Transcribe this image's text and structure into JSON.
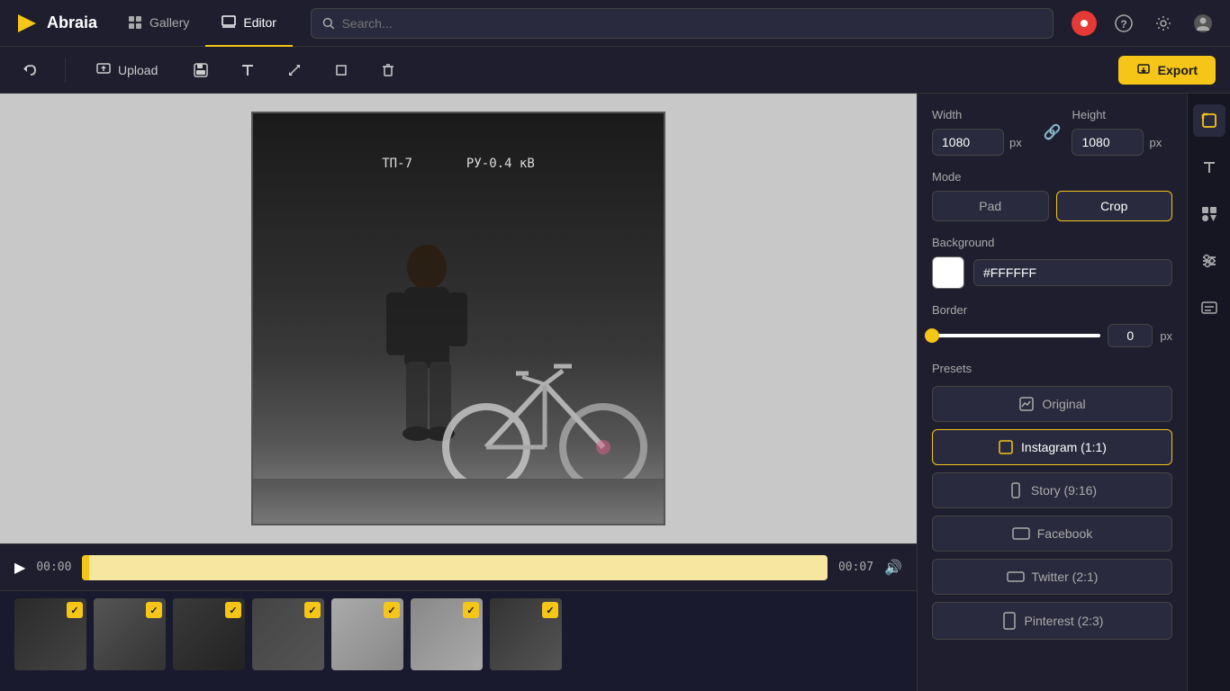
{
  "app": {
    "logo_text": "Abraia",
    "nav": {
      "gallery_label": "Gallery",
      "editor_label": "Editor"
    },
    "search_placeholder": "Search..."
  },
  "toolbar": {
    "upload_label": "Upload",
    "export_label": "Export"
  },
  "canvas": {
    "photo_text1": "ТП-7",
    "photo_text2": "РУ-0.4 кВ"
  },
  "timeline": {
    "current_time": "00:00",
    "total_time": "00:07"
  },
  "right_panel": {
    "width_label": "Width",
    "height_label": "Height",
    "width_value": "1080",
    "height_value": "1080",
    "px_label": "px",
    "mode_label": "Mode",
    "pad_label": "Pad",
    "crop_label": "Crop",
    "background_label": "Background",
    "bg_color_value": "#FFFFFF",
    "border_label": "Border",
    "border_value": "0",
    "border_px": "px",
    "presets_label": "Presets",
    "preset_original": "Original",
    "preset_instagram": "Instagram (1:1)",
    "preset_story": "Story (9:16)",
    "preset_facebook": "Facebook",
    "preset_twitter": "Twitter (2:1)",
    "preset_pinterest": "Pinterest (2:3)"
  },
  "thumbnails": [
    {
      "id": 1,
      "checked": true,
      "bg": "thumb-1"
    },
    {
      "id": 2,
      "checked": true,
      "bg": "thumb-2"
    },
    {
      "id": 3,
      "checked": true,
      "bg": "thumb-3"
    },
    {
      "id": 4,
      "checked": true,
      "bg": "thumb-4"
    },
    {
      "id": 5,
      "checked": true,
      "bg": "thumb-5"
    },
    {
      "id": 6,
      "checked": true,
      "bg": "thumb-6"
    },
    {
      "id": 7,
      "checked": true,
      "bg": "thumb-7"
    }
  ]
}
